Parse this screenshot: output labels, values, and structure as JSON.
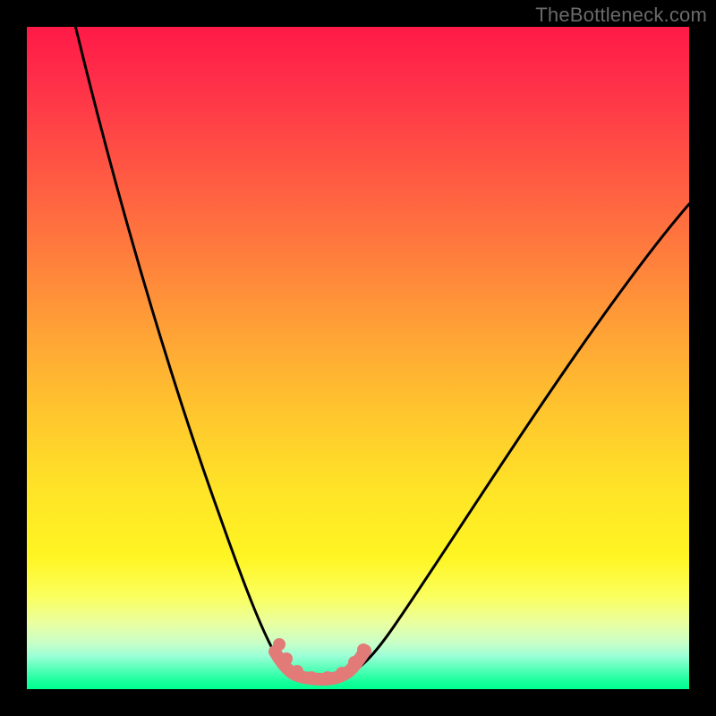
{
  "attribution": "TheBottleneck.com",
  "chart_data": {
    "type": "line",
    "title": "",
    "xlabel": "",
    "ylabel": "",
    "xlim": [
      0,
      100
    ],
    "ylim": [
      0,
      100
    ],
    "background_heatmap": {
      "orientation": "vertical",
      "stops": [
        {
          "pos": 0,
          "color": "#ff1a47",
          "meaning": "high-bottleneck"
        },
        {
          "pos": 50,
          "color": "#ffc52e",
          "meaning": "medium-bottleneck"
        },
        {
          "pos": 85,
          "color": "#fff523",
          "meaning": "low-bottleneck"
        },
        {
          "pos": 100,
          "color": "#00ff8e",
          "meaning": "no-bottleneck"
        }
      ]
    },
    "series": [
      {
        "name": "bottleneck-curve",
        "color": "#000000",
        "x": [
          7,
          12,
          18,
          24,
          30,
          34,
          37,
          40,
          43,
          46,
          48,
          52,
          58,
          66,
          74,
          82,
          90,
          100
        ],
        "y": [
          100,
          82,
          64,
          48,
          34,
          24,
          16,
          8,
          2,
          0,
          2,
          8,
          18,
          32,
          46,
          58,
          66,
          74
        ]
      },
      {
        "name": "optimal-range-dots",
        "color": "#e27a78",
        "x": [
          38,
          39,
          41,
          43,
          45,
          47,
          49,
          51
        ],
        "y": [
          6,
          4,
          2,
          0,
          0,
          1,
          3,
          5
        ]
      }
    ],
    "annotations": []
  }
}
